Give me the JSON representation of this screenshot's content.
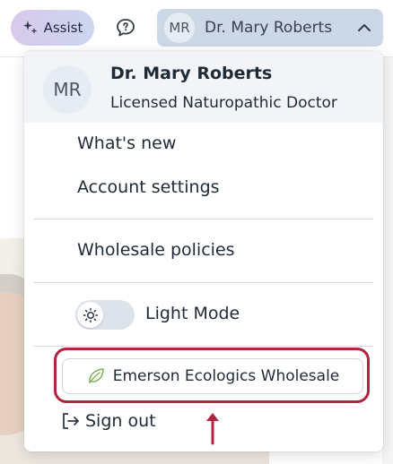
{
  "topbar": {
    "assist_label": "Assist",
    "chat_icon": "chat-bubble-question-icon",
    "user_initials": "MR",
    "user_name": "Dr. Mary Roberts",
    "chevron_icon": "chevron-up-icon"
  },
  "dropdown": {
    "header": {
      "initials": "MR",
      "name": "Dr. Mary Roberts",
      "title": "Licensed Naturopathic Doctor"
    },
    "items": [
      {
        "label": "What's new"
      },
      {
        "label": "Account settings"
      },
      {
        "label": "Wholesale policies"
      }
    ],
    "theme_toggle": {
      "label": "Light Mode",
      "icon": "sun-icon"
    },
    "wholesale_button": {
      "label": "Emerson Ecologics Wholesale",
      "icon": "leaf-icon"
    },
    "signout": {
      "label": "Sign out",
      "icon": "sign-out-icon"
    }
  },
  "annotation": {
    "highlight_color": "#b0243f"
  }
}
